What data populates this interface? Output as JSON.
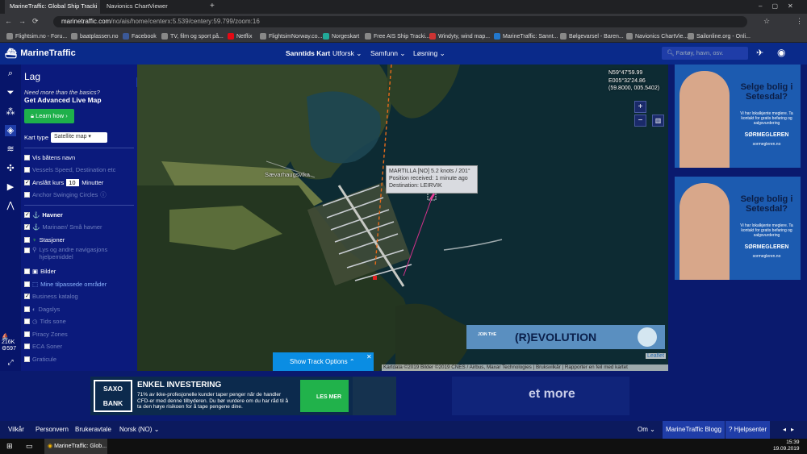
{
  "browser": {
    "tabs": [
      {
        "title": "MarineTraffic: Global Ship Tracki",
        "active": true
      },
      {
        "title": "Navionics ChartViewer",
        "active": false
      }
    ],
    "url_domain": "marinetraffic.com",
    "url_path": "/no/ais/home/centerx:5.539/centery:59.799/zoom:16",
    "bookmarks": [
      "Flightsim.no - Foru...",
      "baatplassen.no",
      "Facebook",
      "TV, film og sport på...",
      "Netflix",
      "FlightsimNorway.co...",
      "Norgeskart",
      "Free AIS Ship Tracki...",
      "Windyty, wind map...",
      "MarineTraffic: Sannt...",
      "Bølgevarsel - Baren...",
      "Navionics ChartVie...",
      "Sailonline.org - Onli..."
    ]
  },
  "header": {
    "brand": "MarineTraffic",
    "nav": [
      "Sanntids Kart",
      "Utforsk",
      "Samfunn",
      "Løsning"
    ],
    "search_placeholder": "Fartøy, havn, osv."
  },
  "rail": {
    "count_vessels": "216K",
    "count_ports": "597"
  },
  "panel": {
    "title": "Lag",
    "promo_q": "Need more than the basics?",
    "promo_cta": "Get Advanced Live Map",
    "learn_btn": "Learn how",
    "map_type_label": "Kart type",
    "map_type_value": "Satellite map",
    "show_names": "Vis båtens navn",
    "vessel_speed": "Vessels Speed, Destination etc",
    "estimated_course": "Anslått kurs",
    "course_minutes": "10",
    "minutes_label": "Minutter",
    "anchor_circles": "Anchor Swinging Circles",
    "ports": "Havner",
    "marinas": "Marinaer/ Små havner",
    "stations": "Stasjoner",
    "lights": "Lys og andre navigasjons hjelpemiddel",
    "photos": "Bilder",
    "custom_areas": "Mine tilpassede områder",
    "business": "Business katalog",
    "dagslys": "Dagslys",
    "tids_sone": "Tids sone",
    "piracy": "Piracy Zones",
    "eca": "ECA Soner",
    "graticule": "Graticule"
  },
  "map": {
    "place_label": "Sævarhaugsvika",
    "coords_lat": "N59°47'59.99",
    "coords_lon": "E005°32'24.86",
    "coords_dec": "(59.8000, 005.5402)",
    "info_line1": "MARTILLA [NO] 5.2 knots / 201°",
    "info_line2": "Position received: 1 minute ago",
    "info_line3": "Destination: LEIRVIK",
    "zoom_in": "+",
    "zoom_out": "−",
    "track_btn": "Show Track Options",
    "leaflet": "Leaflet",
    "attribution": "Kartdata ©2019 Bilder ©2019 CNES / Airbus, Maxar Technologies  |  Bruksvilkår  |  Rapporter en feil med kartet",
    "ad_join": "JOIN THE",
    "ad_revolution": "(R)EVOLUTION"
  },
  "ads": {
    "right_headline": "Selge bolig i Setesdal?",
    "right_sub": "Vi har lokalkjente meglere. Ta kontakt for gratis befaring og salgsvurdering",
    "right_brand": "SØRMEGLEREN",
    "right_url": "sormegleren.no",
    "saxo_logo1": "SAXO",
    "saxo_logo2": "BANK",
    "saxo_title": "ENKEL INVESTERING",
    "saxo_text": "71% av ikke-profesjonelle kunder taper penger når de handler CFD-er med denne tilbyderen. Du bør vurdere om du har råd til å ta den høye risikoen for å tape pengene dine.",
    "saxo_btn": "LES MER",
    "more_text": "et more"
  },
  "footer": {
    "links": [
      "Vilkår",
      "Personvern",
      "Brukeravtale",
      "Norsk (NO)"
    ],
    "om": "Om",
    "blog": "MarineTraffic Blogg",
    "help": "Hjelpsenter"
  },
  "taskbar": {
    "app": "MarineTraffic: Glob...",
    "time": "15:39",
    "date": "19.09.2019"
  }
}
